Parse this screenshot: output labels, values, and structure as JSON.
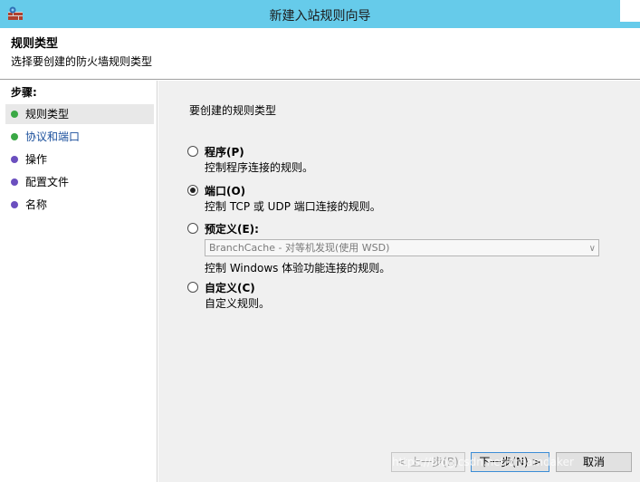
{
  "window": {
    "title": "新建入站规则向导",
    "app_icon": "firewall-icon"
  },
  "header": {
    "title": "规则类型",
    "subtitle": "选择要创建的防火墙规则类型"
  },
  "steps": {
    "title": "步骤:",
    "items": [
      {
        "label": "规则类型",
        "dot_color": "#3aa845"
      },
      {
        "label": "协议和端口",
        "dot_color": "#3aa845"
      },
      {
        "label": "操作",
        "dot_color": "#6b4fbf"
      },
      {
        "label": "配置文件",
        "dot_color": "#6b4fbf"
      },
      {
        "label": "名称",
        "dot_color": "#6b4fbf"
      }
    ]
  },
  "main": {
    "prompt": "要创建的规则类型",
    "options": [
      {
        "label": "程序(P)",
        "description": "控制程序连接的规则。",
        "checked": false
      },
      {
        "label": "端口(O)",
        "description": "控制 TCP 或 UDP 端口连接的规则。",
        "checked": true
      },
      {
        "label": "预定义(E):",
        "description": "控制 Windows 体验功能连接的规则。",
        "checked": false,
        "dropdown_value": "BranchCache - 对等机发现(使用 WSD)"
      },
      {
        "label": "自定义(C)",
        "description": "自定义规则。",
        "checked": false
      }
    ]
  },
  "buttons": {
    "back": "< 上一步(B)",
    "next": "下一步(N) >",
    "cancel": "取消"
  },
  "watermark": "https://blog.csdn.net/dreamdaker"
}
